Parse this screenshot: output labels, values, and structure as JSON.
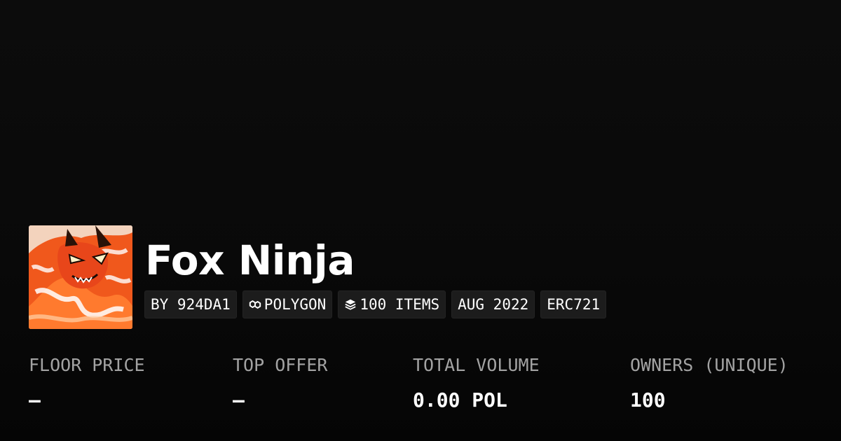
{
  "collection": {
    "name": "Fox Ninja",
    "avatar_icon": "fox-ninja-artwork",
    "accent_colors": [
      "#f0581c",
      "#ff8a3a",
      "#f3f0ec"
    ]
  },
  "chips": {
    "creator": "BY 924DA1",
    "chain": {
      "icon": "polygon-icon",
      "label": "POLYGON"
    },
    "items": {
      "icon": "layers-icon",
      "label": "100 ITEMS"
    },
    "date": "AUG 2022",
    "standard": "ERC721"
  },
  "stats": [
    {
      "label": "FLOOR PRICE",
      "value": "–"
    },
    {
      "label": "TOP OFFER",
      "value": "–"
    },
    {
      "label": "TOTAL VOLUME",
      "value": "0.00 POL"
    },
    {
      "label": "OWNERS (UNIQUE)",
      "value": "100"
    }
  ]
}
